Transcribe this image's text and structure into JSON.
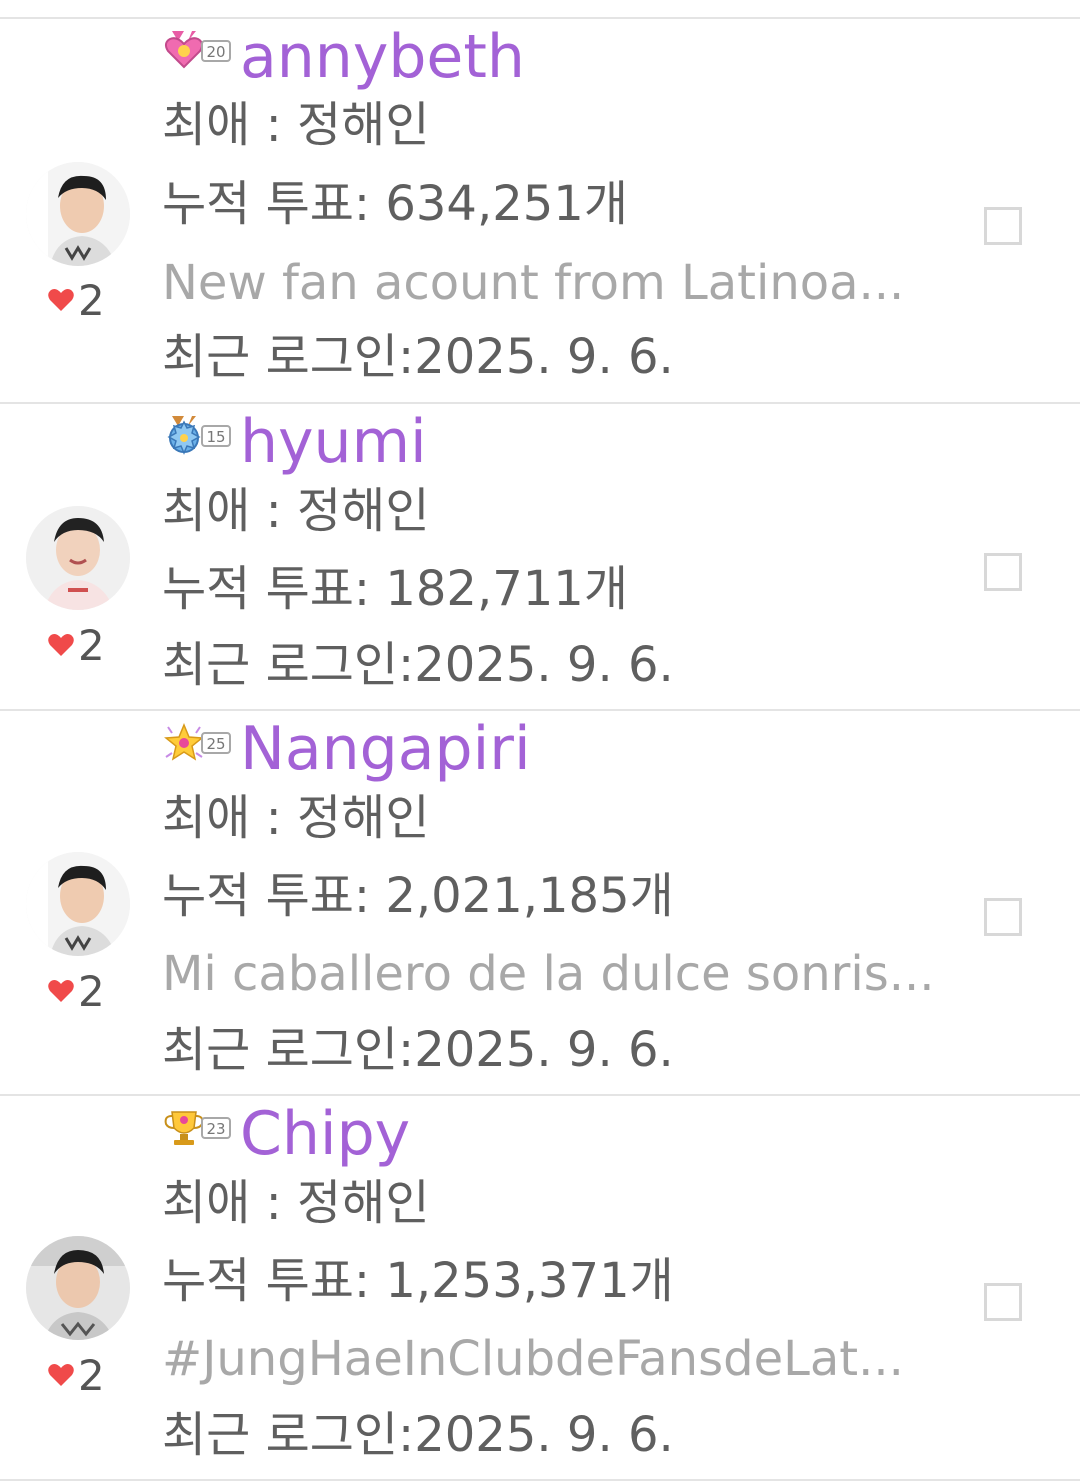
{
  "users": [
    {
      "name": "annybeth",
      "level": "20",
      "badge_icon": "heart-medal-icon",
      "favorite": "최애 : 정해인",
      "votes": "누적 투표: 634,251개",
      "bio": "New fan acount from Latinoa...",
      "last_login": "최근 로그인:2025. 9. 6.",
      "likes": "2"
    },
    {
      "name": "hyumi",
      "level": "15",
      "badge_icon": "gear-medal-icon",
      "favorite": "최애 : 정해인",
      "votes": "누적 투표: 182,711개",
      "bio": "",
      "last_login": "최근 로그인:2025. 9. 6.",
      "likes": "2"
    },
    {
      "name": "Nangapiri",
      "level": "25",
      "badge_icon": "star-medal-icon",
      "favorite": "최애 : 정해인",
      "votes": "누적 투표: 2,021,185개",
      "bio": "Mi caballero de la dulce sonris...",
      "last_login": "최근 로그인:2025. 9. 6.",
      "likes": "2"
    },
    {
      "name": "Chipy",
      "level": "23",
      "badge_icon": "trophy-medal-icon",
      "favorite": "최애 : 정해인",
      "votes": "누적 투표: 1,253,371개",
      "bio": "#JungHaeInClubdeFansdeLat...",
      "last_login": "최근 로그인:2025. 9. 6.",
      "likes": "2"
    }
  ],
  "colors": {
    "username": "#a362d6",
    "text": "#5f5f5f",
    "bio": "#a8a8a8",
    "heart": "#f04a4a",
    "divider": "#e4e4e4"
  }
}
